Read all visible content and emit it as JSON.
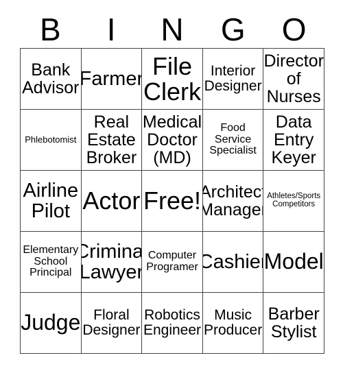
{
  "card": {
    "title_letters": [
      "B",
      "I",
      "N",
      "G",
      "O"
    ],
    "rows": [
      [
        {
          "text": "Bank\nAdvisor",
          "size": "md"
        },
        {
          "text": "Farmer",
          "size": "lg"
        },
        {
          "text": "File\nClerk",
          "size": "xxl"
        },
        {
          "text": "Interior\nDesigner",
          "size": "sm"
        },
        {
          "text": "Director\nof\nNurses",
          "size": "md"
        }
      ],
      [
        {
          "text": "Phlebotomist",
          "size": "xxs"
        },
        {
          "text": "Real\nEstate\nBroker",
          "size": "md"
        },
        {
          "text": "Medical\nDoctor\n(MD)",
          "size": "md"
        },
        {
          "text": "Food\nService\nSpecialist",
          "size": "xs"
        },
        {
          "text": "Data\nEntry\nKeyer",
          "size": "md"
        }
      ],
      [
        {
          "text": "Airline\nPilot",
          "size": "lg"
        },
        {
          "text": "Actor",
          "size": "xxl"
        },
        {
          "text": "Free!",
          "size": "xxl"
        },
        {
          "text": "Architect\nManager",
          "size": "md"
        },
        {
          "text": "Athletes/Sports\nCompetitors",
          "size": "tiny"
        }
      ],
      [
        {
          "text": "Elementary\nSchool\nPrincipal",
          "size": "xs"
        },
        {
          "text": "Criminal\nLawyer",
          "size": "lg"
        },
        {
          "text": "Computer\nProgramer",
          "size": "xs"
        },
        {
          "text": "Cashier",
          "size": "lg"
        },
        {
          "text": "Model",
          "size": "xl"
        }
      ],
      [
        {
          "text": "Judge",
          "size": "xl"
        },
        {
          "text": "Floral\nDesigner",
          "size": "sm"
        },
        {
          "text": "Robotics\nEngineer",
          "size": "sm"
        },
        {
          "text": "Music\nProducer",
          "size": "sm"
        },
        {
          "text": "Barber\nStylist",
          "size": "md"
        }
      ]
    ],
    "colors": {
      "background": "#ffffff",
      "text": "#000000",
      "border": "#444444"
    }
  }
}
